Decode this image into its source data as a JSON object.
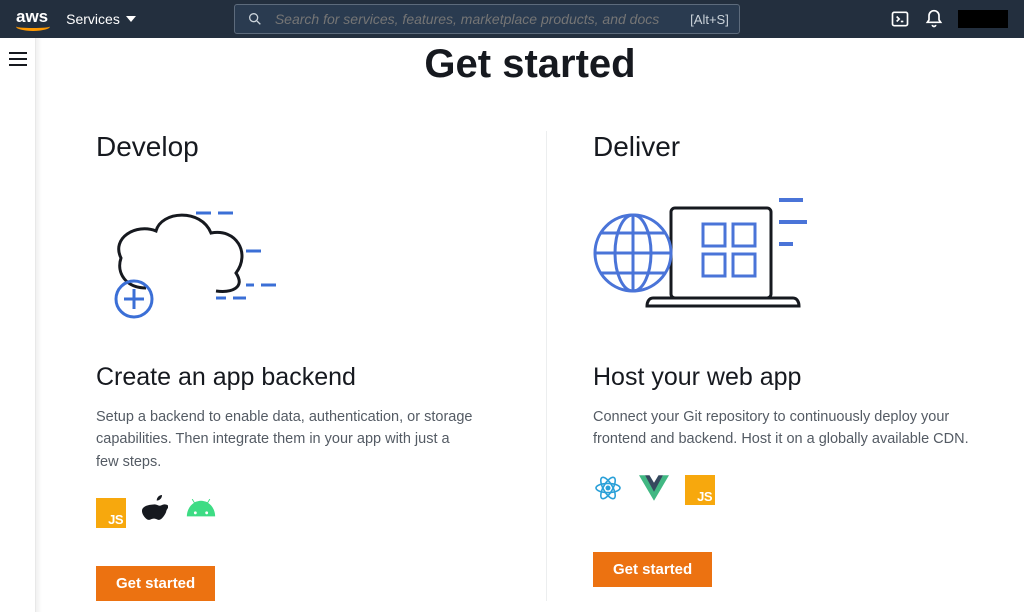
{
  "nav": {
    "services_label": "Services",
    "search_placeholder": "Search for services, features, marketplace products, and docs",
    "search_shortcut": "[Alt+S]"
  },
  "page": {
    "title": "Get started"
  },
  "cards": {
    "develop": {
      "kicker": "Develop",
      "title": "Create an app backend",
      "desc": "Setup a backend to enable data, authentication, or storage capabilities. Then integrate them in your app with just a few steps.",
      "cta": "Get started"
    },
    "deliver": {
      "kicker": "Deliver",
      "title": "Host your web app",
      "desc": "Connect your Git repository to continuously deploy your frontend and backend. Host it on a globally available CDN.",
      "cta": "Get started"
    }
  },
  "icons": {
    "js_label": "JS"
  }
}
